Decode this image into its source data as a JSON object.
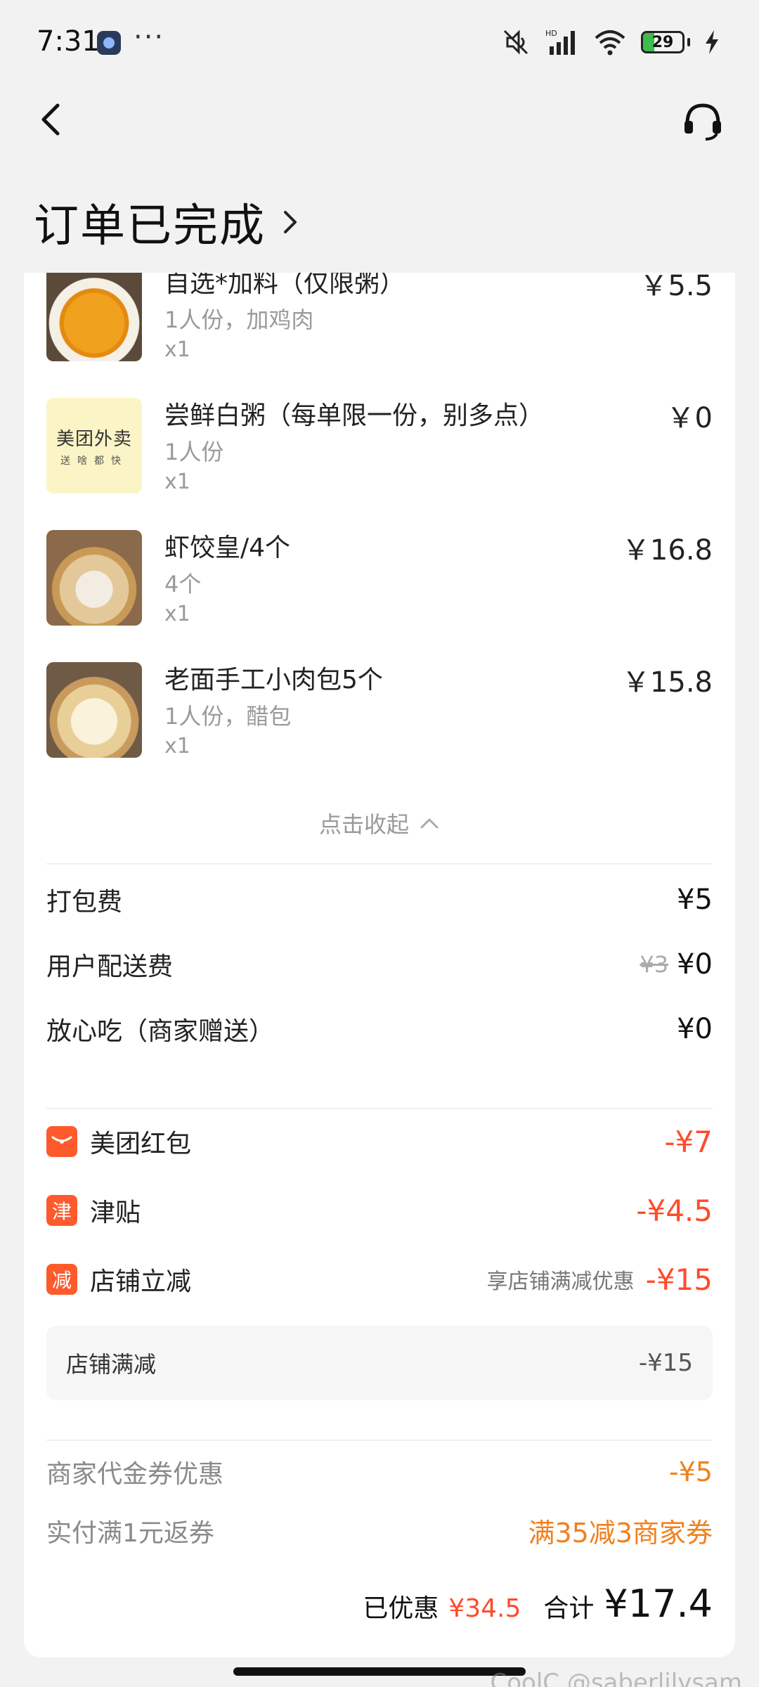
{
  "status_bar": {
    "time": "7:31",
    "more": "···",
    "network_label": "HD",
    "battery_level": "29",
    "battery_fraction": 0.29
  },
  "header": {
    "title": "订单已完成",
    "back_icon": "back-arrow-icon",
    "service_icon": "headset-icon"
  },
  "items": [
    {
      "name": "自选*加料（仅限粥）",
      "spec": "1人份，加鸡肉",
      "qty": "x1",
      "price": "￥5.5"
    },
    {
      "name": "尝鲜白粥（每单限一份，别多点）",
      "spec": "1人份",
      "qty": "x1",
      "price": "￥0"
    },
    {
      "name": "虾饺皇/4个",
      "spec": "4个",
      "qty": "x1",
      "price": "￥16.8"
    },
    {
      "name": "老面手工小肉包5个",
      "spec": "1人份，醋包",
      "qty": "x1",
      "price": "￥15.8"
    }
  ],
  "logo_thumb": {
    "line1": "美团外卖",
    "line2": "送啥都快"
  },
  "collapse_label": "点击收起",
  "fees": {
    "packing": {
      "label": "打包费",
      "value": "¥5"
    },
    "delivery": {
      "label": "用户配送费",
      "original": "¥3",
      "value": "¥0"
    },
    "worry_free": {
      "label": "放心吃（商家赠送）",
      "value": "¥0"
    }
  },
  "discounts": {
    "red_packet": {
      "label": "美团红包",
      "value": "-¥7"
    },
    "subsidy": {
      "badge": "津",
      "label": "津贴",
      "value": "-¥4.5"
    },
    "store": {
      "badge": "减",
      "label": "店铺立减",
      "note": "享店铺满减优惠",
      "value": "-¥15"
    },
    "store_detail": {
      "label": "店铺满减",
      "value": "-¥15"
    }
  },
  "extras": {
    "voucher": {
      "label": "商家代金券优惠",
      "value": "-¥5"
    },
    "rebate": {
      "label": "实付满1元返券",
      "value": "满35减3商家券"
    }
  },
  "total": {
    "saved_label": "已优惠",
    "saved_value": "¥34.5",
    "total_label": "合计",
    "total_value": "¥17.4"
  },
  "watermark": "CoolC @saberlilysam",
  "colors": {
    "accent_red": "#ff4b2b",
    "accent_orange": "#f0811e",
    "badge": "#ff5a2b"
  }
}
